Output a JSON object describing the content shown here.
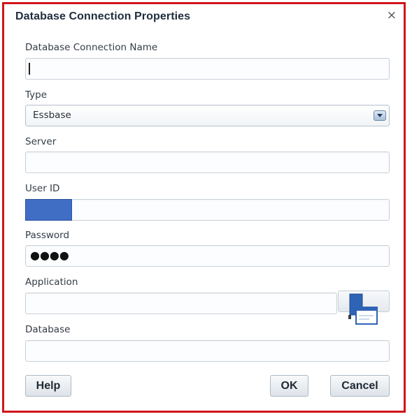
{
  "dialog": {
    "title": "Database Connection Properties",
    "close_label": "×"
  },
  "fields": {
    "connection_name": {
      "label": "Database Connection Name",
      "value": ""
    },
    "type": {
      "label": "Type",
      "value": "Essbase"
    },
    "server": {
      "label": "Server",
      "value": ""
    },
    "user_id": {
      "label": "User ID",
      "value": ""
    },
    "password": {
      "label": "Password",
      "value": "●●●●"
    },
    "application": {
      "label": "Application",
      "value": ""
    },
    "database": {
      "label": "Database",
      "value": ""
    }
  },
  "buttons": {
    "help": "Help",
    "ok": "OK",
    "cancel": "Cancel"
  },
  "icons": {
    "application_picker": "window-picker-icon",
    "dropdown": "chevron-down-icon",
    "close": "close-icon"
  },
  "colors": {
    "border_accent": "#d0141a",
    "redaction": "#3f6ec4"
  }
}
